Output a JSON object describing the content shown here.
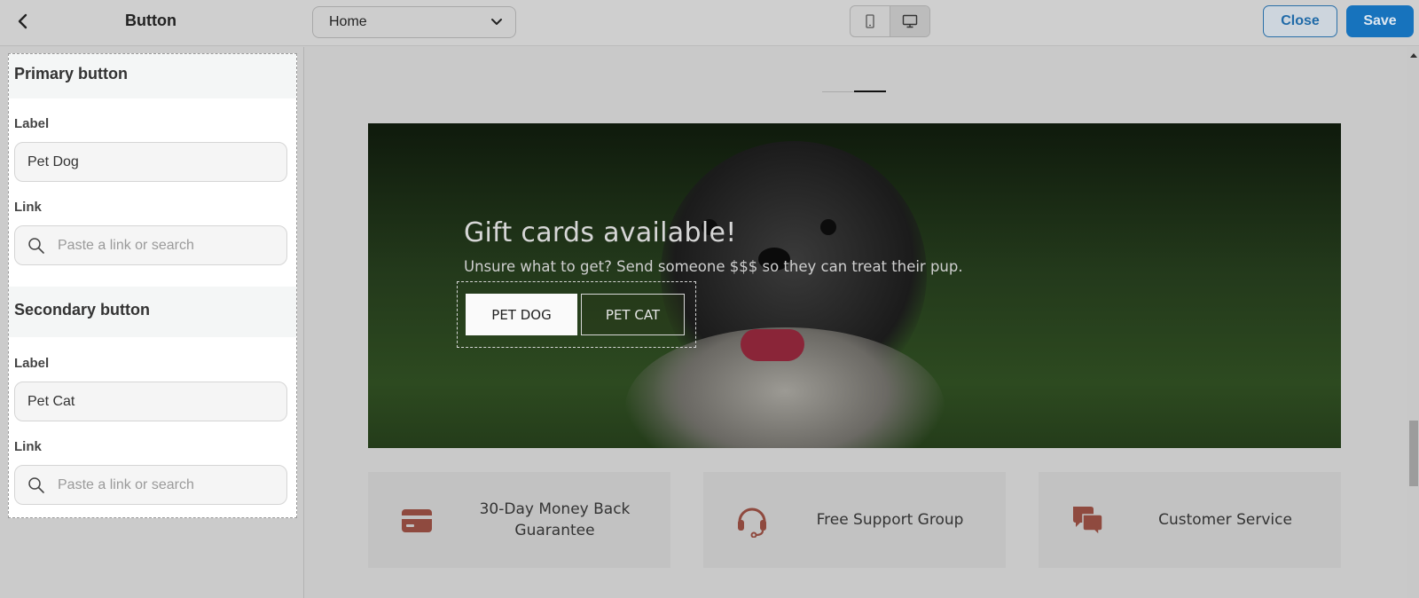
{
  "header": {
    "panel_title": "Button",
    "page_select": "Home",
    "close_label": "Close",
    "save_label": "Save"
  },
  "editor": {
    "primary": {
      "heading": "Primary button",
      "label_caption": "Label",
      "label_value": "Pet Dog",
      "link_caption": "Link",
      "link_placeholder": "Paste a link or search"
    },
    "secondary": {
      "heading": "Secondary button",
      "label_caption": "Label",
      "label_value": "Pet Cat",
      "link_caption": "Link",
      "link_placeholder": "Paste a link or search"
    }
  },
  "preview": {
    "hero": {
      "title": "Gift cards available!",
      "subtitle": "Unsure what to get? Send someone $$$ so they can treat their pup.",
      "primary_button": "PET DOG",
      "secondary_button": "PET CAT"
    },
    "features": [
      {
        "icon": "credit-card-icon",
        "text": "30-Day Money Back Guarantee"
      },
      {
        "icon": "headset-icon",
        "text": "Free Support Group"
      },
      {
        "icon": "chat-bubbles-icon",
        "text": "Customer Service"
      }
    ]
  },
  "colors": {
    "accent": "#1773bd",
    "feature_icon": "#8f4a3f"
  }
}
